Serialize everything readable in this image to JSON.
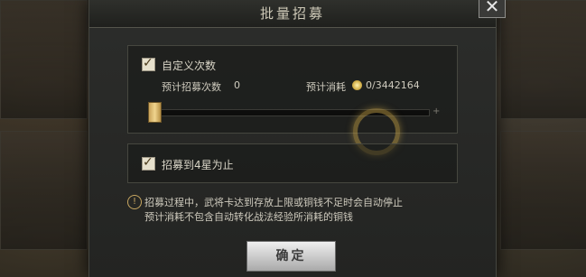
{
  "dialog": {
    "title": "批量招募",
    "close_symbol": "✕"
  },
  "custom": {
    "checkbox_label": "自定义次数",
    "checked": true,
    "estimated_count_label": "预计招募次数",
    "estimated_count_value": "0",
    "estimated_cost_label": "预计消耗",
    "estimated_cost_value": "0/3442164",
    "slider_value": 0
  },
  "stop_option": {
    "checkbox_label": "招募到4星为止",
    "checked": true
  },
  "notes": {
    "line1": "招募过程中，武将卡达到存放上限或铜钱不足时会自动停止",
    "line2": "预计消耗不包含自动转化战法经验所消耗的铜钱"
  },
  "confirm_button": "确定",
  "icons": {
    "check": "✓",
    "info": "!",
    "plus": "+"
  }
}
